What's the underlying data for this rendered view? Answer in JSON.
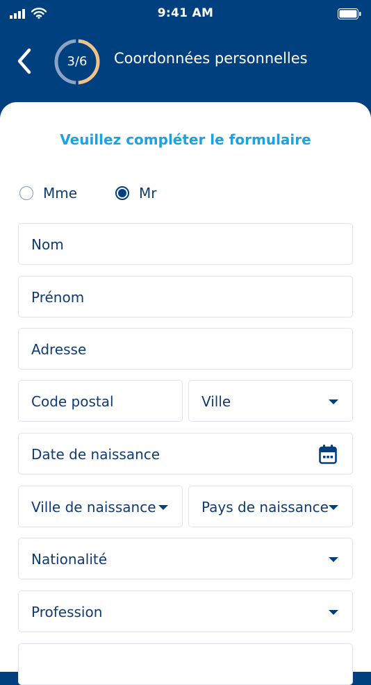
{
  "status_bar": {
    "time": "9:41 AM"
  },
  "header": {
    "step": "3/6",
    "step_fraction": 0.5,
    "title": "Coordonnées personnelles"
  },
  "colors": {
    "header_bg": "#00407f",
    "accent": "#1aa3e1",
    "progress_done": "#f3c28b",
    "progress_todo": "#8aa3c6",
    "text": "#0f3b73"
  },
  "form": {
    "title": "Veuillez compléter le formulaire",
    "civility": {
      "options": [
        "Mme",
        "Mr"
      ],
      "selected": "Mr"
    },
    "fields": {
      "nom": "Nom",
      "prenom": "Prénom",
      "adresse": "Adresse",
      "code_postal": "Code postal",
      "ville": "Ville",
      "date_naissance": "Date de naissance",
      "ville_naissance": "Ville de naissance",
      "pays_naissance": "Pays de naissance",
      "nationalite": "Nationalité",
      "profession": "Profession"
    }
  },
  "icons": [
    "signal-icon",
    "wifi-icon",
    "battery-icon",
    "back-chevron-icon",
    "calendar-icon",
    "chevron-down-icon"
  ]
}
